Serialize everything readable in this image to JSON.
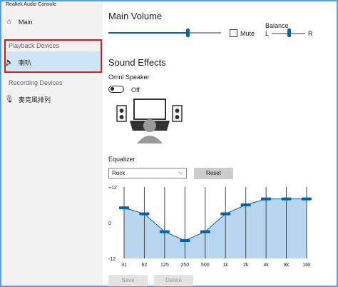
{
  "window": {
    "title": "Realtek Audio Console"
  },
  "sidebar": {
    "main_label": "Main",
    "playback_section": "Playback Devices",
    "playback_item": "喇叭",
    "recording_section": "Recording Devices",
    "recording_item": "麥克風排列"
  },
  "main_volume": {
    "title": "Main Volume",
    "level": 0.7,
    "mute_label": "Mute",
    "balance_label": "Balance",
    "balance_left": "L",
    "balance_right": "R",
    "balance_level": 0.5
  },
  "sound_effects": {
    "title": "Sound Effects",
    "omni_label": "Omni Speaker",
    "omni_state": "Off"
  },
  "equalizer": {
    "title": "Equalizer",
    "preset": "Rock",
    "reset_label": "Reset",
    "save_label": "Save",
    "delete_label": "Delete",
    "y_max_label": "+12",
    "y_mid_label": "0",
    "y_min_label": "-12",
    "ylim": [
      -12,
      12
    ],
    "bands": [
      "31",
      "62",
      "125",
      "250",
      "500",
      "1k",
      "2k",
      "4k",
      "8k",
      "16k"
    ],
    "values": [
      5,
      3,
      -3,
      -6,
      -3,
      3,
      6,
      8,
      8,
      8
    ]
  },
  "colors": {
    "accent": "#0063b1",
    "highlight_border": "#d71920",
    "selection": "#cfe4f7",
    "eq_fill": "#b9d6f0"
  }
}
